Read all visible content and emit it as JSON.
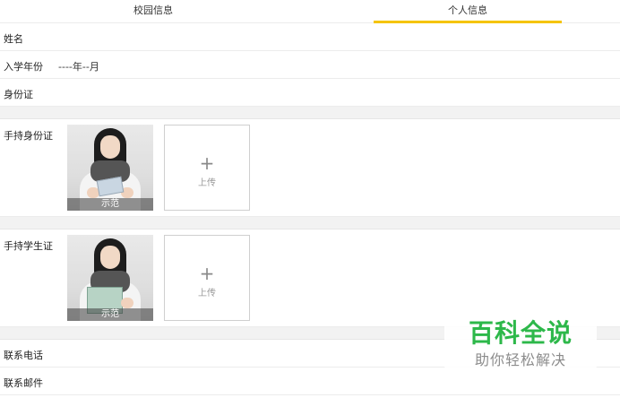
{
  "tabs": {
    "campus": "校园信息",
    "personal": "个人信息"
  },
  "colors": {
    "accent": "#f5c400",
    "watermark_green": "#2db84a",
    "divider": "#ececec",
    "section_gap": "#f2f2f2"
  },
  "form": {
    "name_label": "姓名",
    "enroll_label": "入学年份",
    "enroll_value": "----年--月",
    "id_label": "身份证",
    "hold_id_label": "手持身份证",
    "hold_student_label": "手持学生证",
    "phone_label": "联系电话",
    "email_label": "联系邮件"
  },
  "uploads": {
    "sample_caption": "示范",
    "upload_label": "上传",
    "plus_icon": "plus-icon"
  },
  "watermark": {
    "title": "百科全说",
    "subtitle": "助你轻松解决"
  }
}
